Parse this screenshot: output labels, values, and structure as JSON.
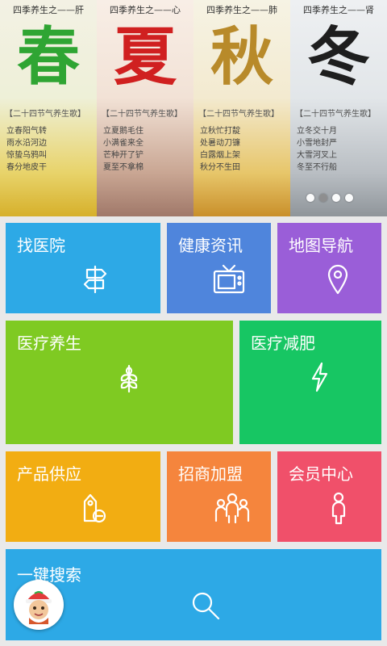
{
  "banner": {
    "panels": [
      {
        "sub": "四季养生之——肝",
        "big": "春",
        "color": "#2fa533",
        "caption": "【二十四节气养生歌】",
        "poem": [
          "立春阳气转",
          "雨水沿河边",
          "惊蛰乌鸦叫",
          "春分地皮干"
        ]
      },
      {
        "sub": "四季养生之——心",
        "big": "夏",
        "color": "#d02020",
        "caption": "【二十四节气养生歌】",
        "poem": [
          "立夏鹅毛住",
          "小满雀来全",
          "芒种开了铲",
          "夏至不拿棉"
        ]
      },
      {
        "sub": "四季养生之——肺",
        "big": "秋",
        "color": "#b88a2a",
        "caption": "【二十四节气养生歌】",
        "poem": [
          "立秋忙打靛",
          "处暑动刀镰",
          "白露烟上架",
          "秋分不生田"
        ]
      },
      {
        "sub": "四季养生之——肾",
        "big": "冬",
        "color": "#1e1e1e",
        "caption": "【二十四节气养生歌】",
        "poem": [
          "立冬交十月",
          "小雪地封严",
          "大雪河叉上",
          "冬至不行船"
        ]
      }
    ],
    "active_index": 1
  },
  "tiles": {
    "find_hospital": {
      "label": "找医院",
      "color": "#2da9e6"
    },
    "health_news": {
      "label": "健康资讯",
      "color": "#4f85dc"
    },
    "map_nav": {
      "label": "地图导航",
      "color": "#9a5ed8"
    },
    "medical_health": {
      "label": "医疗养生",
      "color": "#7fca22"
    },
    "medical_slim": {
      "label": "医疗减肥",
      "color": "#17c663"
    },
    "product_supply": {
      "label": "产品供应",
      "color": "#f2ad12"
    },
    "franchise": {
      "label": "招商加盟",
      "color": "#f5853d"
    },
    "member_center": {
      "label": "会员中心",
      "color": "#f0506a"
    },
    "search": {
      "label": "一键搜索",
      "color": "#2da9e6"
    }
  }
}
